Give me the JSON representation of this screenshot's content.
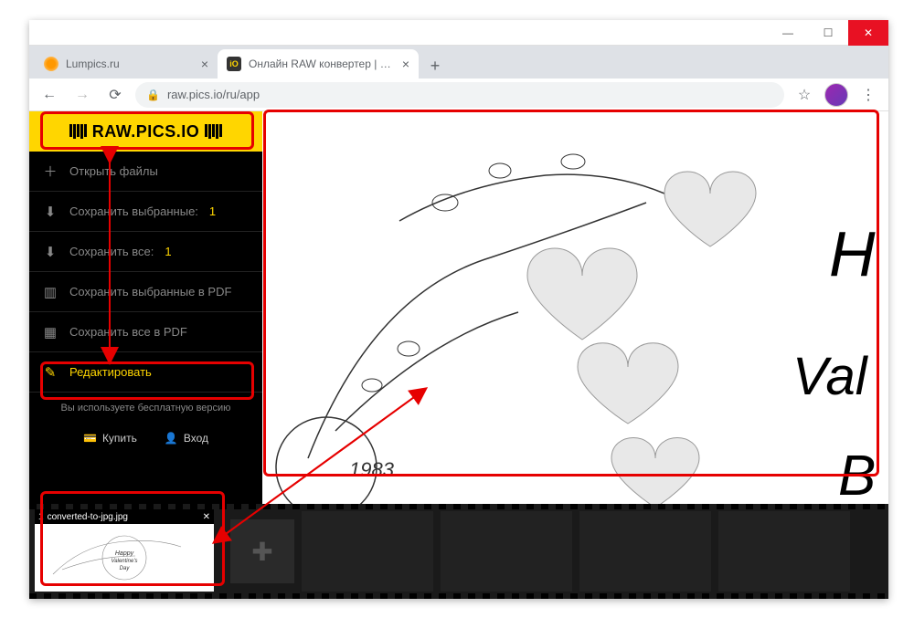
{
  "window": {
    "tabs": [
      {
        "title": "Lumpics.ru"
      },
      {
        "title": "Онлайн RAW конвертер | Обра..."
      }
    ],
    "url": "raw.pics.io/ru/app"
  },
  "logo_text": "RAW.PICS.IO",
  "sidebar": {
    "open_files": "Открыть файлы",
    "save_selected": "Сохранить выбранные:",
    "save_selected_count": "1",
    "save_all": "Сохранить все:",
    "save_all_count": "1",
    "save_selected_pdf": "Сохранить выбранные в PDF",
    "save_all_pdf": "Сохранить все в PDF",
    "edit": "Редактировать",
    "free_note": "Вы используете бесплатную версию",
    "buy": "Купить",
    "login": "Вход"
  },
  "filmstrip": {
    "thumb_index": "1",
    "thumb_name": "converted-to-jpg.jpg"
  },
  "preview_year": "1983"
}
